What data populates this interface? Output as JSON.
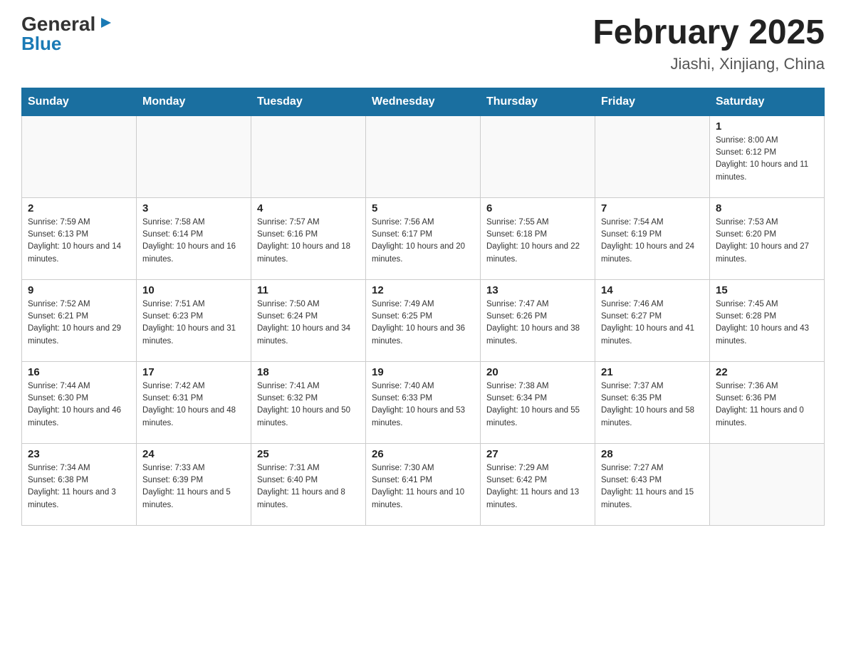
{
  "header": {
    "logo_general": "General",
    "logo_blue": "Blue",
    "title": "February 2025",
    "subtitle": "Jiashi, Xinjiang, China"
  },
  "days_of_week": [
    "Sunday",
    "Monday",
    "Tuesday",
    "Wednesday",
    "Thursday",
    "Friday",
    "Saturday"
  ],
  "weeks": [
    [
      {
        "day": "",
        "info": ""
      },
      {
        "day": "",
        "info": ""
      },
      {
        "day": "",
        "info": ""
      },
      {
        "day": "",
        "info": ""
      },
      {
        "day": "",
        "info": ""
      },
      {
        "day": "",
        "info": ""
      },
      {
        "day": "1",
        "info": "Sunrise: 8:00 AM\nSunset: 6:12 PM\nDaylight: 10 hours and 11 minutes."
      }
    ],
    [
      {
        "day": "2",
        "info": "Sunrise: 7:59 AM\nSunset: 6:13 PM\nDaylight: 10 hours and 14 minutes."
      },
      {
        "day": "3",
        "info": "Sunrise: 7:58 AM\nSunset: 6:14 PM\nDaylight: 10 hours and 16 minutes."
      },
      {
        "day": "4",
        "info": "Sunrise: 7:57 AM\nSunset: 6:16 PM\nDaylight: 10 hours and 18 minutes."
      },
      {
        "day": "5",
        "info": "Sunrise: 7:56 AM\nSunset: 6:17 PM\nDaylight: 10 hours and 20 minutes."
      },
      {
        "day": "6",
        "info": "Sunrise: 7:55 AM\nSunset: 6:18 PM\nDaylight: 10 hours and 22 minutes."
      },
      {
        "day": "7",
        "info": "Sunrise: 7:54 AM\nSunset: 6:19 PM\nDaylight: 10 hours and 24 minutes."
      },
      {
        "day": "8",
        "info": "Sunrise: 7:53 AM\nSunset: 6:20 PM\nDaylight: 10 hours and 27 minutes."
      }
    ],
    [
      {
        "day": "9",
        "info": "Sunrise: 7:52 AM\nSunset: 6:21 PM\nDaylight: 10 hours and 29 minutes."
      },
      {
        "day": "10",
        "info": "Sunrise: 7:51 AM\nSunset: 6:23 PM\nDaylight: 10 hours and 31 minutes."
      },
      {
        "day": "11",
        "info": "Sunrise: 7:50 AM\nSunset: 6:24 PM\nDaylight: 10 hours and 34 minutes."
      },
      {
        "day": "12",
        "info": "Sunrise: 7:49 AM\nSunset: 6:25 PM\nDaylight: 10 hours and 36 minutes."
      },
      {
        "day": "13",
        "info": "Sunrise: 7:47 AM\nSunset: 6:26 PM\nDaylight: 10 hours and 38 minutes."
      },
      {
        "day": "14",
        "info": "Sunrise: 7:46 AM\nSunset: 6:27 PM\nDaylight: 10 hours and 41 minutes."
      },
      {
        "day": "15",
        "info": "Sunrise: 7:45 AM\nSunset: 6:28 PM\nDaylight: 10 hours and 43 minutes."
      }
    ],
    [
      {
        "day": "16",
        "info": "Sunrise: 7:44 AM\nSunset: 6:30 PM\nDaylight: 10 hours and 46 minutes."
      },
      {
        "day": "17",
        "info": "Sunrise: 7:42 AM\nSunset: 6:31 PM\nDaylight: 10 hours and 48 minutes."
      },
      {
        "day": "18",
        "info": "Sunrise: 7:41 AM\nSunset: 6:32 PM\nDaylight: 10 hours and 50 minutes."
      },
      {
        "day": "19",
        "info": "Sunrise: 7:40 AM\nSunset: 6:33 PM\nDaylight: 10 hours and 53 minutes."
      },
      {
        "day": "20",
        "info": "Sunrise: 7:38 AM\nSunset: 6:34 PM\nDaylight: 10 hours and 55 minutes."
      },
      {
        "day": "21",
        "info": "Sunrise: 7:37 AM\nSunset: 6:35 PM\nDaylight: 10 hours and 58 minutes."
      },
      {
        "day": "22",
        "info": "Sunrise: 7:36 AM\nSunset: 6:36 PM\nDaylight: 11 hours and 0 minutes."
      }
    ],
    [
      {
        "day": "23",
        "info": "Sunrise: 7:34 AM\nSunset: 6:38 PM\nDaylight: 11 hours and 3 minutes."
      },
      {
        "day": "24",
        "info": "Sunrise: 7:33 AM\nSunset: 6:39 PM\nDaylight: 11 hours and 5 minutes."
      },
      {
        "day": "25",
        "info": "Sunrise: 7:31 AM\nSunset: 6:40 PM\nDaylight: 11 hours and 8 minutes."
      },
      {
        "day": "26",
        "info": "Sunrise: 7:30 AM\nSunset: 6:41 PM\nDaylight: 11 hours and 10 minutes."
      },
      {
        "day": "27",
        "info": "Sunrise: 7:29 AM\nSunset: 6:42 PM\nDaylight: 11 hours and 13 minutes."
      },
      {
        "day": "28",
        "info": "Sunrise: 7:27 AM\nSunset: 6:43 PM\nDaylight: 11 hours and 15 minutes."
      },
      {
        "day": "",
        "info": ""
      }
    ]
  ]
}
